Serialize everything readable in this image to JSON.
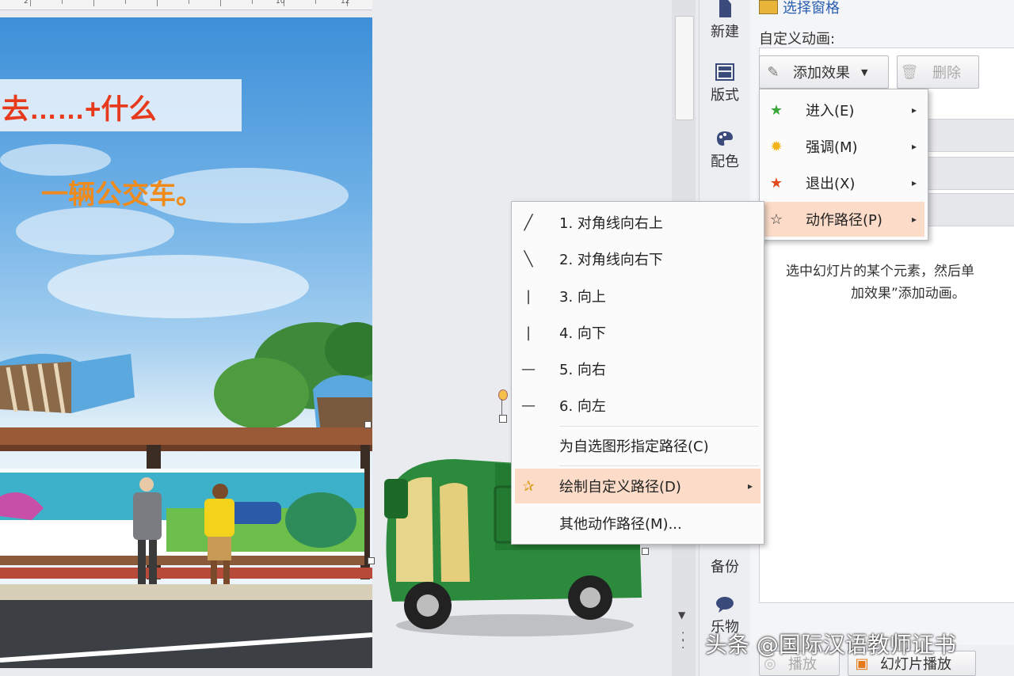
{
  "slide": {
    "line1": "去……+什么",
    "line2": "一辆公交车。"
  },
  "ruler": {
    "marks": [
      "2",
      "4",
      "6",
      "8",
      "10",
      "12"
    ]
  },
  "side_toolbar": {
    "new_label": "新建",
    "layout_label": "版式",
    "color_label": "配色",
    "backup_label": "备份",
    "collab_label": "乐物"
  },
  "task_pane": {
    "select_pane_link": "选择窗格",
    "custom_animation_label": "自定义动画:",
    "add_effect_label": "添加效果",
    "delete_label": "删除",
    "hint_line1": "选中幻灯片的某个元素，然后单",
    "hint_line2": "加效果”添加动画。",
    "play_label": "播放",
    "slideshow_label": "幻灯片播放"
  },
  "effect_menu": {
    "items": [
      {
        "label": "进入(E)",
        "icon": "green-star-icon"
      },
      {
        "label": "强调(M)",
        "icon": "yellow-star-icon"
      },
      {
        "label": "退出(X)",
        "icon": "red-star-icon"
      },
      {
        "label": "动作路径(P)",
        "icon": "outline-star-icon"
      }
    ]
  },
  "path_menu": {
    "items": [
      {
        "label": "1. 对角线向右上",
        "icon": "diagonal-up-icon"
      },
      {
        "label": "2. 对角线向右下",
        "icon": "diagonal-down-icon"
      },
      {
        "label": "3. 向上",
        "icon": "vertical-line-icon"
      },
      {
        "label": "4. 向下",
        "icon": "vertical-line-icon"
      },
      {
        "label": "5. 向右",
        "icon": "horizontal-line-icon"
      },
      {
        "label": "6. 向左",
        "icon": "horizontal-line-icon"
      },
      {
        "label": "为自选图形指定路径(C)",
        "icon": ""
      },
      {
        "label": "绘制自定义路径(D)",
        "icon": "custom-path-icon"
      },
      {
        "label": "其他动作路径(M)...",
        "icon": ""
      }
    ]
  },
  "watermark": "头条 @国际汉语教师证书",
  "colors": {
    "highlight": "#fcdcc8",
    "slide_title_red": "#e73a1d",
    "slide_title_orange": "#f08a1a",
    "bus_green": "#2c8a3c"
  }
}
